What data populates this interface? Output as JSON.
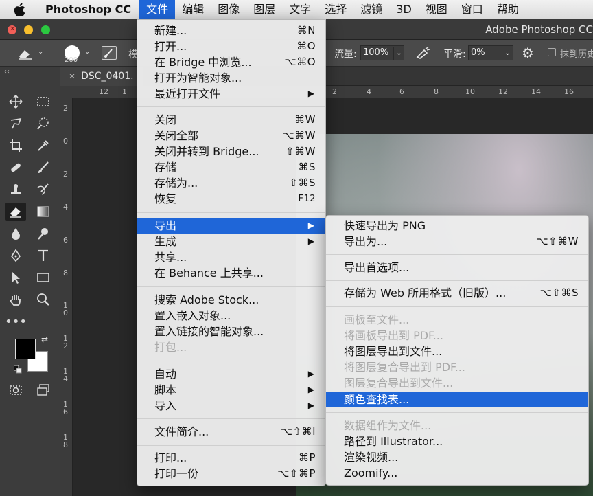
{
  "menubar": {
    "app_name": "Photoshop CC",
    "items": [
      "文件",
      "编辑",
      "图像",
      "图层",
      "文字",
      "选择",
      "滤镜",
      "3D",
      "视图",
      "窗口",
      "帮助"
    ],
    "active_index": 0
  },
  "window": {
    "title": "Adobe Photoshop CC"
  },
  "options_bar": {
    "brush_size": "200",
    "mode_label_fragment": "模",
    "flow_label": "流量:",
    "flow_value": "100%",
    "smoothing_label": "平滑:",
    "smoothing_value": "0%",
    "erase_history_label": "抹到历史"
  },
  "document": {
    "tab_title": "DSC_0401."
  },
  "rulers": {
    "top_left": [
      "12",
      "1"
    ],
    "top_right": [
      "2",
      "4",
      "6",
      "8",
      "10",
      "12",
      "14",
      "16"
    ],
    "left": [
      "2",
      "0",
      "2",
      "4",
      "6",
      "8",
      "1 0",
      "1 2",
      "1 4",
      "1 6",
      "1 8"
    ]
  },
  "file_menu": {
    "groups": [
      [
        {
          "label": "新建...",
          "shortcut": "⌘N"
        },
        {
          "label": "打开...",
          "shortcut": "⌘O"
        },
        {
          "label": "在 Bridge 中浏览...",
          "shortcut": "⌥⌘O"
        },
        {
          "label": "打开为智能对象..."
        },
        {
          "label": "最近打开文件",
          "submenu": true
        }
      ],
      [
        {
          "label": "关闭",
          "shortcut": "⌘W"
        },
        {
          "label": "关闭全部",
          "shortcut": "⌥⌘W"
        },
        {
          "label": "关闭并转到 Bridge...",
          "shortcut": "⇧⌘W"
        },
        {
          "label": "存储",
          "shortcut": "⌘S"
        },
        {
          "label": "存储为...",
          "shortcut": "⇧⌘S"
        },
        {
          "label": "恢复",
          "shortcut": "F12"
        }
      ],
      [
        {
          "label": "导出",
          "submenu": true,
          "highlighted": true
        },
        {
          "label": "生成",
          "submenu": true
        },
        {
          "label": "共享..."
        },
        {
          "label": "在 Behance 上共享..."
        }
      ],
      [
        {
          "label": "搜索 Adobe Stock..."
        },
        {
          "label": "置入嵌入对象..."
        },
        {
          "label": "置入链接的智能对象..."
        },
        {
          "label": "打包...",
          "disabled": true
        }
      ],
      [
        {
          "label": "自动",
          "submenu": true
        },
        {
          "label": "脚本",
          "submenu": true
        },
        {
          "label": "导入",
          "submenu": true
        }
      ],
      [
        {
          "label": "文件简介...",
          "shortcut": "⌥⇧⌘I"
        }
      ],
      [
        {
          "label": "打印...",
          "shortcut": "⌘P"
        },
        {
          "label": "打印一份",
          "shortcut": "⌥⇧⌘P"
        }
      ]
    ]
  },
  "export_menu": {
    "groups": [
      [
        {
          "label": "快速导出为 PNG"
        },
        {
          "label": "导出为...",
          "shortcut": "⌥⇧⌘W"
        }
      ],
      [
        {
          "label": "导出首选项..."
        }
      ],
      [
        {
          "label": "存储为 Web 所用格式（旧版）...",
          "shortcut": "⌥⇧⌘S"
        }
      ],
      [
        {
          "label": "画板至文件...",
          "disabled": true
        },
        {
          "label": "将画板导出到 PDF...",
          "disabled": true
        },
        {
          "label": "将图层导出到文件..."
        },
        {
          "label": "将图层复合导出到 PDF...",
          "disabled": true
        },
        {
          "label": "图层复合导出到文件...",
          "disabled": true
        },
        {
          "label": "颜色查找表...",
          "highlighted": true
        }
      ],
      [
        {
          "label": "数据组作为文件...",
          "disabled": true
        },
        {
          "label": "路径到 Illustrator..."
        },
        {
          "label": "渲染视频..."
        },
        {
          "label": "Zoomify..."
        }
      ]
    ]
  },
  "colors": {
    "highlight": "#1f66d8",
    "foreground": "#000000",
    "background": "#ffffff"
  }
}
